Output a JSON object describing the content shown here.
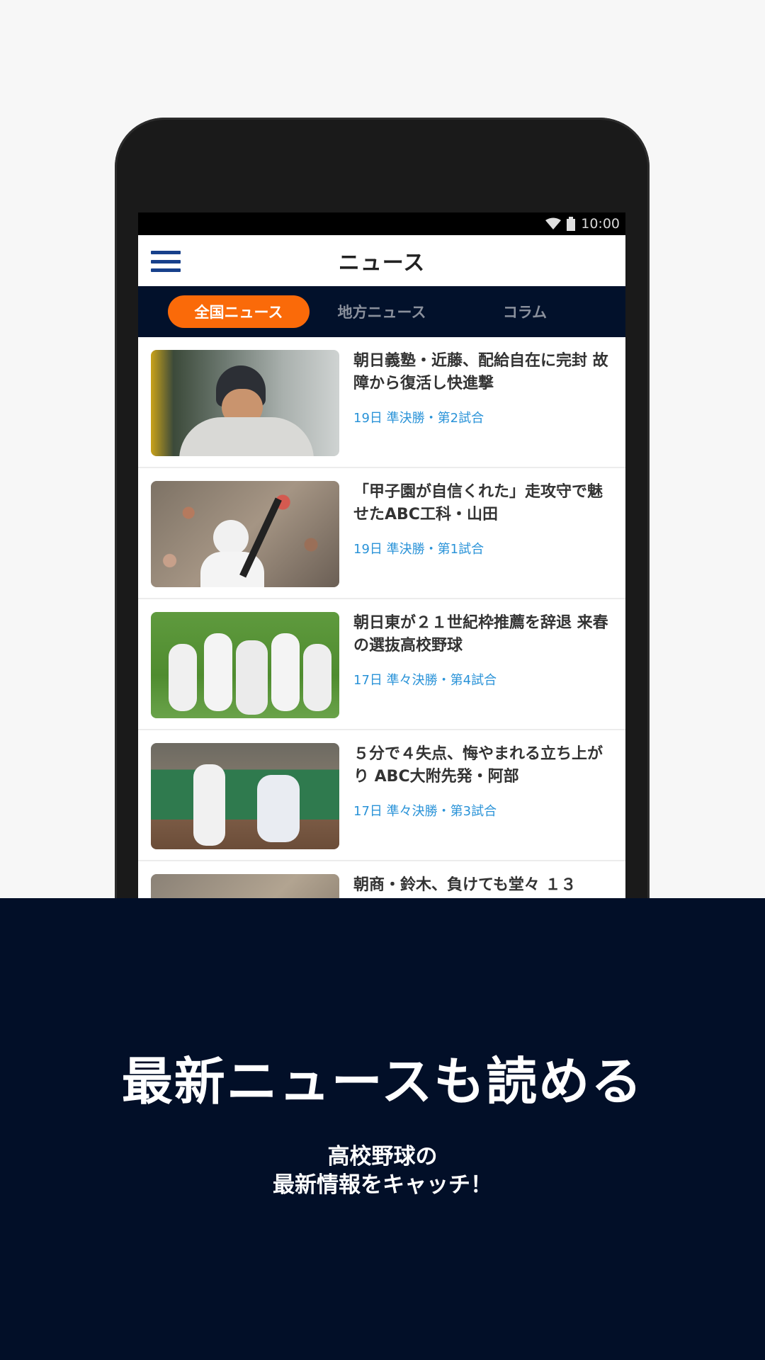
{
  "status_bar": {
    "time": "10:00"
  },
  "app_bar": {
    "title": "ニュース",
    "menu_icon": "hamburger-menu-icon"
  },
  "tabs": [
    {
      "label": "全国ニュース",
      "active": true
    },
    {
      "label": "地方ニュース",
      "active": false
    },
    {
      "label": "コラム",
      "active": false
    }
  ],
  "news": [
    {
      "headline": "朝日義塾・近藤、配給自在に完封 故障から復活し快進撃",
      "meta": "19日 準決勝・第2試合"
    },
    {
      "headline": "「甲子園が自信くれた」走攻守で魅せたABC工科・山田",
      "meta": "19日 準決勝・第1試合"
    },
    {
      "headline": "朝日東が２１世紀枠推薦を辞退 来春の選抜高校野球",
      "meta": "17日 準々決勝・第4試合"
    },
    {
      "headline": "５分で４失点、悔やまれる立ち上がり ABC大附先発・阿部",
      "meta": "17日 準々決勝・第3試合"
    },
    {
      "headline": "朝商・鈴木、負けても堂々 １３",
      "meta": ""
    }
  ],
  "promo": {
    "title": "最新ニュースも読める",
    "subtitle_line1": "高校野球の",
    "subtitle_line2": "最新情報をキャッチ！"
  },
  "colors": {
    "accent": "#fa6a09",
    "navy": "#02112b",
    "link_blue": "#2a93d8"
  }
}
